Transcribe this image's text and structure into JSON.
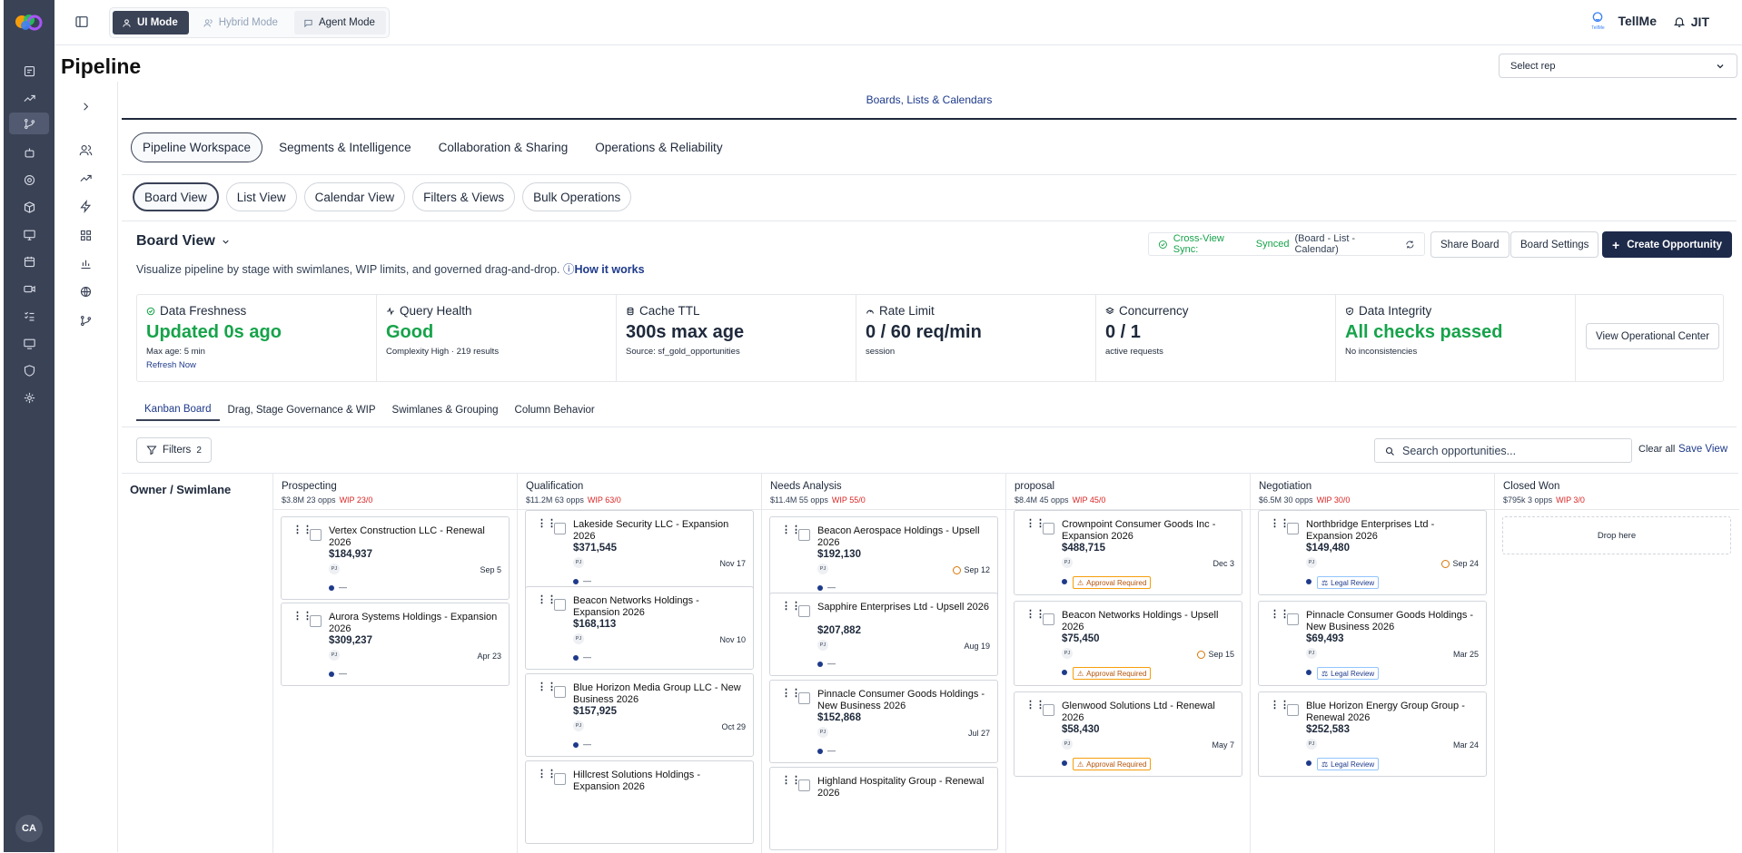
{
  "topbar": {
    "modes": [
      {
        "label": "UI Mode",
        "icon": "user-icon"
      },
      {
        "label": "Hybrid Mode",
        "icon": "users-icon"
      },
      {
        "label": "Agent Mode",
        "icon": "chat-icon"
      }
    ],
    "tellme": "TellMe",
    "tellme_logo_caption": "TellMe",
    "jit": "JIT"
  },
  "page": {
    "title": "Pipeline",
    "select_rep_placeholder": "Select rep"
  },
  "user": {
    "initials": "CA"
  },
  "section_title": "Boards, Lists & Calendars",
  "top_tabs": [
    "Pipeline Workspace",
    "Segments & Intelligence",
    "Collaboration & Sharing",
    "Operations & Reliability"
  ],
  "view_tabs": [
    "Board View",
    "List View",
    "Calendar View",
    "Filters & Views",
    "Bulk Operations"
  ],
  "board": {
    "title": "Board View",
    "description": "Visualize pipeline by stage with swimlanes, WIP limits, and governed drag-and-drop.",
    "how_it_works": "How it works",
    "sync_label": "Cross-View Sync:",
    "sync_status": "Synced",
    "sync_detail": "(Board - List - Calendar)",
    "share": "Share Board",
    "settings": "Board Settings",
    "create": "Create Opportunity"
  },
  "stats": [
    {
      "label": "Data Freshness",
      "value": "Updated 0s ago",
      "green": true,
      "sub": "Max age: 5 min",
      "link": "Refresh Now"
    },
    {
      "label": "Query Health",
      "value": "Good",
      "green": true,
      "sub": "Complexity High · 219 results"
    },
    {
      "label": "Cache TTL",
      "value": "300s max age",
      "green": false,
      "sub": "Source: sf_gold_opportunities"
    },
    {
      "label": "Rate Limit",
      "value": "0 / 60 req/min",
      "green": false,
      "sub": "session"
    },
    {
      "label": "Concurrency",
      "value": "0 / 1",
      "green": false,
      "sub": "active requests"
    },
    {
      "label": "Data Integrity",
      "value": "All checks passed",
      "green": true,
      "sub": "No inconsistencies"
    }
  ],
  "view_ops": "View Operational Center",
  "sub_tabs": [
    "Kanban Board",
    "Drag, Stage Governance & WIP",
    "Swimlanes & Grouping",
    "Column Behavior"
  ],
  "filters": {
    "label": "Filters",
    "count": "2",
    "search_placeholder": "Search opportunities...",
    "clear_all": "Clear all",
    "save_view": "Save View"
  },
  "swimlane_header": "Owner / Swimlane",
  "columns": [
    {
      "name": "Prospecting",
      "value": "$3.8M",
      "opps": "23 opps",
      "wip": "WIP 23/0",
      "cards": [
        {
          "title": "Vertex Construction LLC - Renewal 2026",
          "amount": "$184,937",
          "date": "Sep 5",
          "overdue": false,
          "tag": ""
        },
        {
          "title": "Aurora Systems Holdings - Expansion 2026",
          "amount": "$309,237",
          "date": "Apr 23",
          "overdue": false,
          "tag": ""
        }
      ]
    },
    {
      "name": "Qualification",
      "value": "$11.2M",
      "opps": "63 opps",
      "wip": "WIP 63/0",
      "cards": [
        {
          "title": "Lakeside Security LLC - Expansion 2026",
          "amount": "$371,545",
          "date": "Nov 17",
          "overdue": false,
          "tag": ""
        },
        {
          "title": "Beacon Networks Holdings - Expansion 2026",
          "amount": "$168,113",
          "date": "Nov 10",
          "overdue": false,
          "tag": ""
        },
        {
          "title": "Blue Horizon Media Group LLC - New Business 2026",
          "amount": "$157,925",
          "date": "Oct 29",
          "overdue": false,
          "tag": ""
        },
        {
          "title": "Hillcrest Solutions Holdings - Expansion 2026",
          "amount": "",
          "date": "",
          "overdue": false,
          "tag": ""
        }
      ]
    },
    {
      "name": "Needs Analysis",
      "value": "$11.4M",
      "opps": "55 opps",
      "wip": "WIP 55/0",
      "cards": [
        {
          "title": "Beacon Aerospace Holdings - Upsell 2026",
          "amount": "$192,130",
          "date": "Sep 12",
          "overdue": true,
          "tag": ""
        },
        {
          "title": "Sapphire Enterprises Ltd - Upsell 2026",
          "amount": "$207,882",
          "date": "Aug 19",
          "overdue": false,
          "tag": ""
        },
        {
          "title": "Pinnacle Consumer Goods Holdings - New Business 2026",
          "amount": "$152,868",
          "date": "Jul 27",
          "overdue": false,
          "tag": ""
        },
        {
          "title": "Highland Hospitality Group - Renewal 2026",
          "amount": "",
          "date": "",
          "overdue": false,
          "tag": ""
        }
      ]
    },
    {
      "name": "proposal",
      "value": "$8.4M",
      "opps": "45 opps",
      "wip": "WIP 45/0",
      "cards": [
        {
          "title": "Crownpoint Consumer Goods Inc - Expansion 2026",
          "amount": "$488,715",
          "date": "Dec 3",
          "overdue": false,
          "tag": "Approval Required"
        },
        {
          "title": "Beacon Networks Holdings - Upsell 2026",
          "amount": "$75,450",
          "date": "Sep 15",
          "overdue": true,
          "tag": "Approval Required"
        },
        {
          "title": "Glenwood Solutions Ltd - Renewal 2026",
          "amount": "$58,430",
          "date": "May 7",
          "overdue": false,
          "tag": "Approval Required"
        }
      ]
    },
    {
      "name": "Negotiation",
      "value": "$6.5M",
      "opps": "30 opps",
      "wip": "WIP 30/0",
      "cards": [
        {
          "title": "Northbridge Enterprises Ltd - Expansion 2026",
          "amount": "$149,480",
          "date": "Sep 24",
          "overdue": true,
          "tag": "Legal Review"
        },
        {
          "title": "Pinnacle Consumer Goods Holdings - New Business 2026",
          "amount": "$69,493",
          "date": "Mar 25",
          "overdue": false,
          "tag": "Legal Review"
        },
        {
          "title": "Blue Horizon Energy Group Group - Renewal 2026",
          "amount": "$252,583",
          "date": "Mar 24",
          "overdue": false,
          "tag": "Legal Review"
        }
      ]
    },
    {
      "name": "Closed Won",
      "value": "$795k",
      "opps": "3 opps",
      "wip": "WIP 3/0",
      "drop": "Drop here",
      "cards": []
    }
  ],
  "card_avatar": "PJ",
  "card_dash": "—"
}
